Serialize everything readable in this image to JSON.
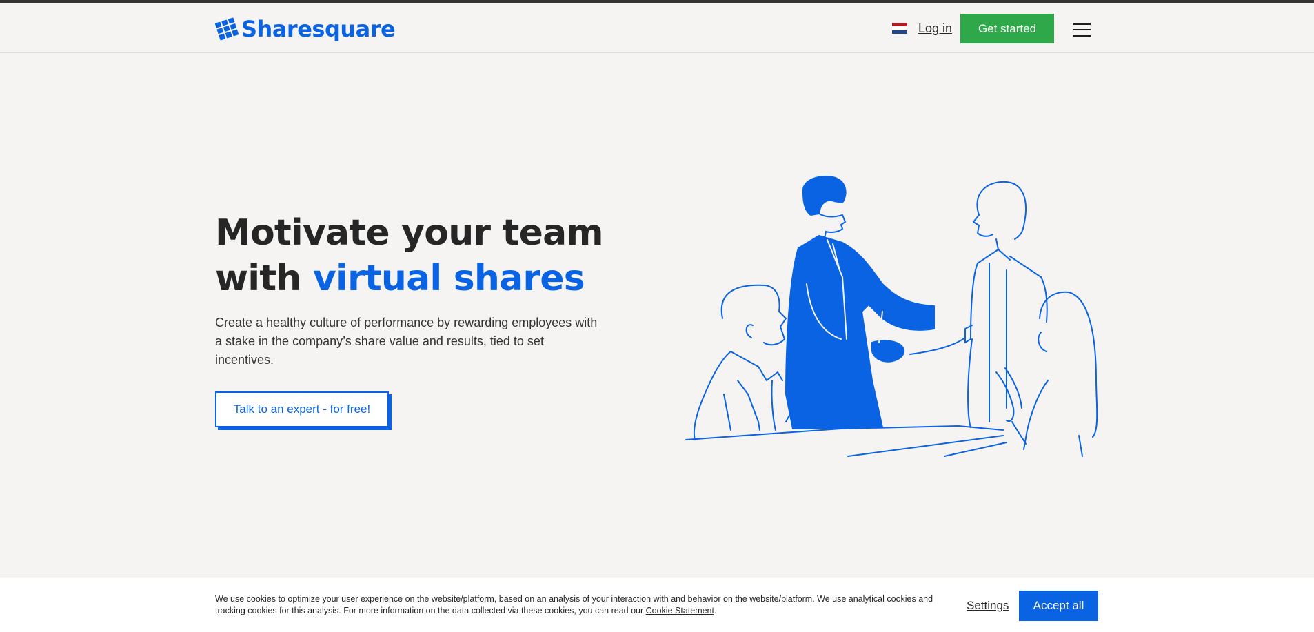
{
  "header": {
    "logo_text": "Sharesquare",
    "login_label": "Log in",
    "get_started_label": "Get started",
    "flag_colors": [
      "#ae1c28",
      "#ffffff",
      "#21468b"
    ]
  },
  "hero": {
    "title_line1": "Motivate your team",
    "title_with": "with ",
    "title_accent": "virtual shares",
    "description": "Create a healthy culture of performance by rewarding employees with a stake in the company’s share value and results, tied to set incentives.",
    "cta_label": "Talk to an expert - for free!"
  },
  "cookie_banner": {
    "text": "We use cookies to optimize your user experience on the website/platform, based on an analysis of your interaction with and behavior on the website/platform. We use analytical cookies and tracking cookies for this analysis. For more information on the data collected via these cookies, you can read our ",
    "link_label": "Cookie Statement",
    "text_end": ".",
    "settings_label": "Settings",
    "accept_label": "Accept all"
  },
  "colors": {
    "brand_blue": "#0a63e3",
    "green": "#2fa84a",
    "background": "#f5f4f3"
  }
}
